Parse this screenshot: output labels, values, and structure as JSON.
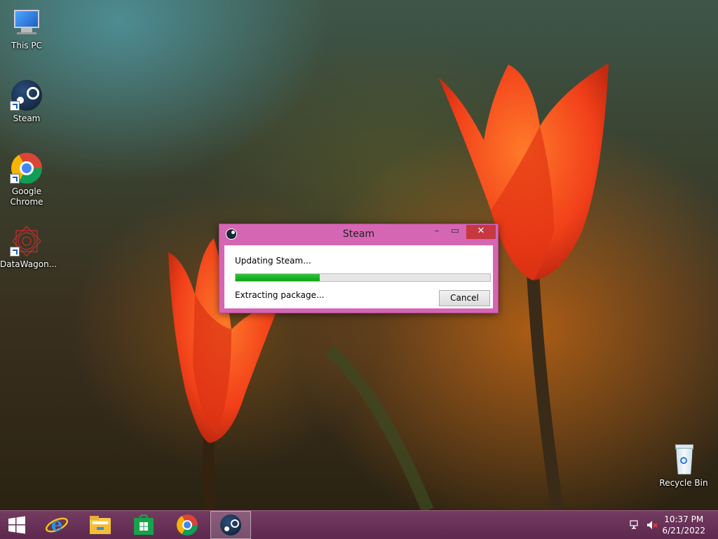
{
  "desktop": {
    "icons": [
      {
        "label": "This PC",
        "icon": "this-pc-icon"
      },
      {
        "label": "Steam",
        "icon": "steam-icon"
      },
      {
        "label": "Google Chrome",
        "icon": "chrome-icon"
      },
      {
        "label": "DataWagon...",
        "icon": "datawagon-icon"
      },
      {
        "label": "Recycle Bin",
        "icon": "recycle-bin-icon"
      }
    ]
  },
  "dialog": {
    "title": "Steam",
    "status": "Updating Steam...",
    "progress_percent": 33,
    "detail": "Extracting package...",
    "cancel_label": "Cancel",
    "minimize_glyph": "–",
    "maximize_glyph": "▭",
    "close_glyph": "✕"
  },
  "taskbar": {
    "items": [
      {
        "name": "start",
        "icon": "windows-start-icon"
      },
      {
        "name": "internet-explorer",
        "icon": "internet-explorer-icon"
      },
      {
        "name": "file-explorer",
        "icon": "file-explorer-icon"
      },
      {
        "name": "store",
        "icon": "store-icon"
      },
      {
        "name": "chrome",
        "icon": "chrome-icon"
      },
      {
        "name": "steam",
        "icon": "steam-icon",
        "active": true
      }
    ],
    "tray": {
      "network_icon": "network-icon",
      "volume_icon": "volume-muted-icon"
    },
    "clock": {
      "time": "10:37 PM",
      "date": "6/21/2022"
    }
  },
  "colors": {
    "dialog_frame": "#d566b4",
    "close_button": "#c7373f",
    "progress_fill": "#06a80f",
    "taskbar": "#6e3560"
  }
}
